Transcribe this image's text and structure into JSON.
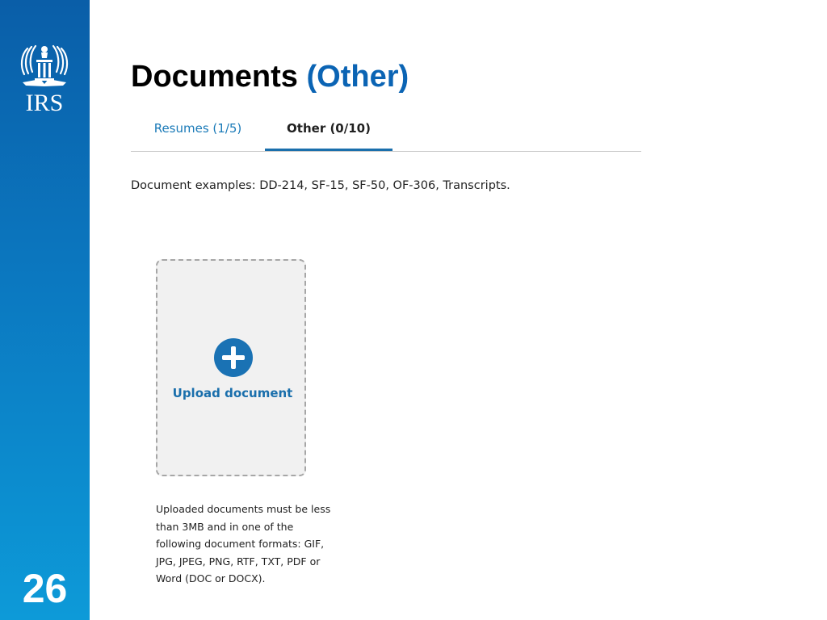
{
  "sidebar": {
    "logo_text": "IRS",
    "slide_number": "26"
  },
  "header": {
    "title_main": "Documents",
    "title_accent": "(Other)",
    "accent_color": "#0b64b4"
  },
  "tabs": [
    {
      "label": "Resumes (1/5)",
      "active": false
    },
    {
      "label": "Other (0/10)",
      "active": true
    }
  ],
  "main": {
    "examples_text": "Document examples: DD-214, SF-15, SF-50, OF-306, Transcripts.",
    "upload": {
      "icon": "plus-circle-icon",
      "label": "Upload document"
    },
    "help_lines": [
      "Uploaded documents must be less",
      "than 3MB and in one of the",
      "following document formats: GIF,",
      "JPG, JPEG, PNG, RTF, TXT, PDF or",
      "Word (DOC or DOCX)."
    ]
  },
  "colors": {
    "sidebar_top": "#0a5ea8",
    "sidebar_bottom": "#0d9ad8",
    "link_blue": "#1a72b4"
  }
}
